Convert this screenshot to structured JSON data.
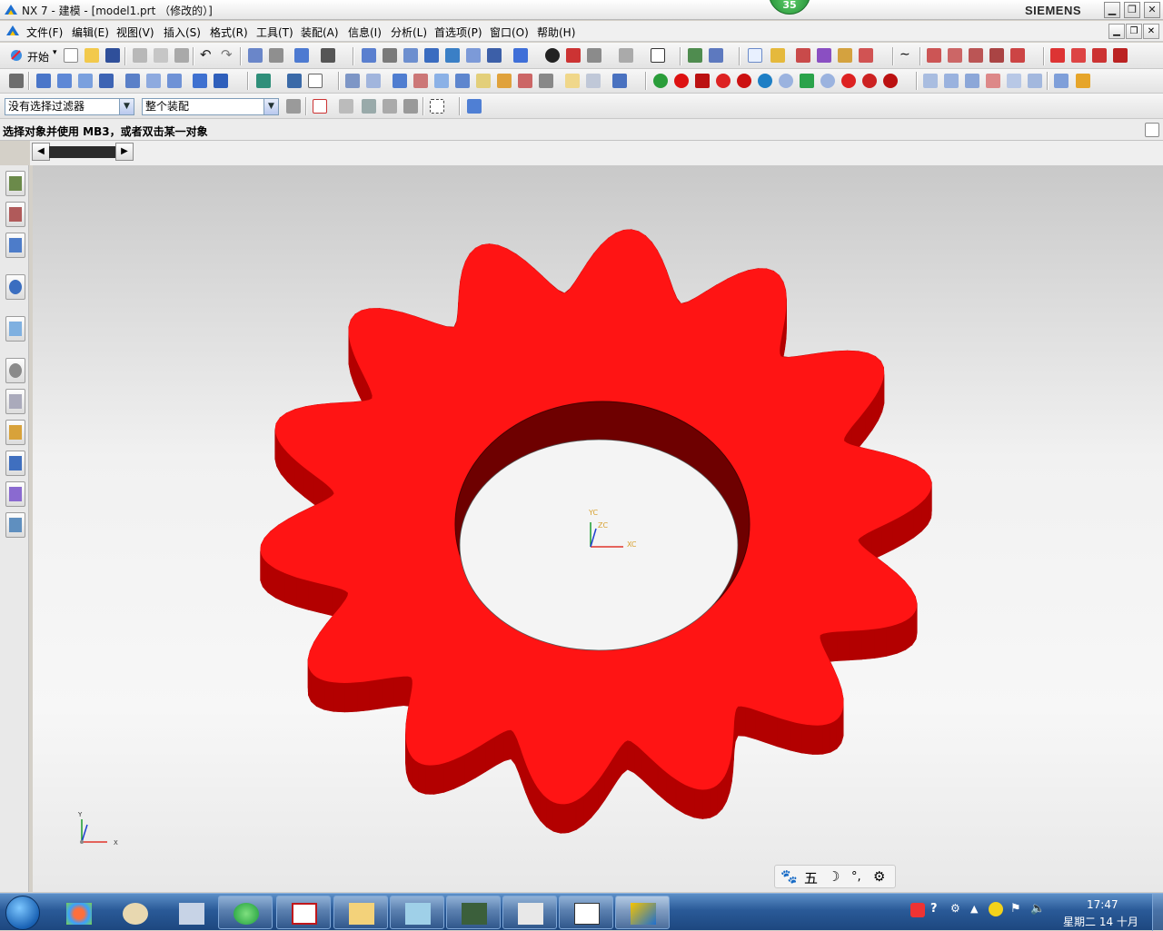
{
  "window": {
    "title": "NX 7 - 建模 - [model1.prt （修改的）]",
    "brand": "SIEMENS",
    "badge": "35"
  },
  "menubar": {
    "items": [
      "文件(F)",
      "编辑(E)",
      "视图(V)",
      "插入(S)",
      "格式(R)",
      "工具(T)",
      "装配(A)",
      "信息(I)",
      "分析(L)",
      "首选项(P)",
      "窗口(O)",
      "帮助(H)"
    ]
  },
  "toolbar": {
    "start_label": "开始"
  },
  "selection": {
    "filter_value": "没有选择过滤器",
    "scope_value": "整个装配"
  },
  "cue_line": "选择对象并使用 MB3，或者双击某一对象",
  "graphics": {
    "wcs_labels": {
      "yc": "YC",
      "zc": "ZC",
      "xc": "XC"
    },
    "triad_labels": {
      "y": "Y",
      "x": "X"
    },
    "model_color": "#ff1414",
    "model_shadow_color": "#8a0000"
  },
  "ime_bar": {
    "items": [
      "paw-icon",
      "五",
      "moon-icon",
      "dots-icon",
      "gear-icon"
    ],
    "char": "五"
  },
  "taskbar": {
    "time": "17:47",
    "date": "星期二 14 十月"
  }
}
